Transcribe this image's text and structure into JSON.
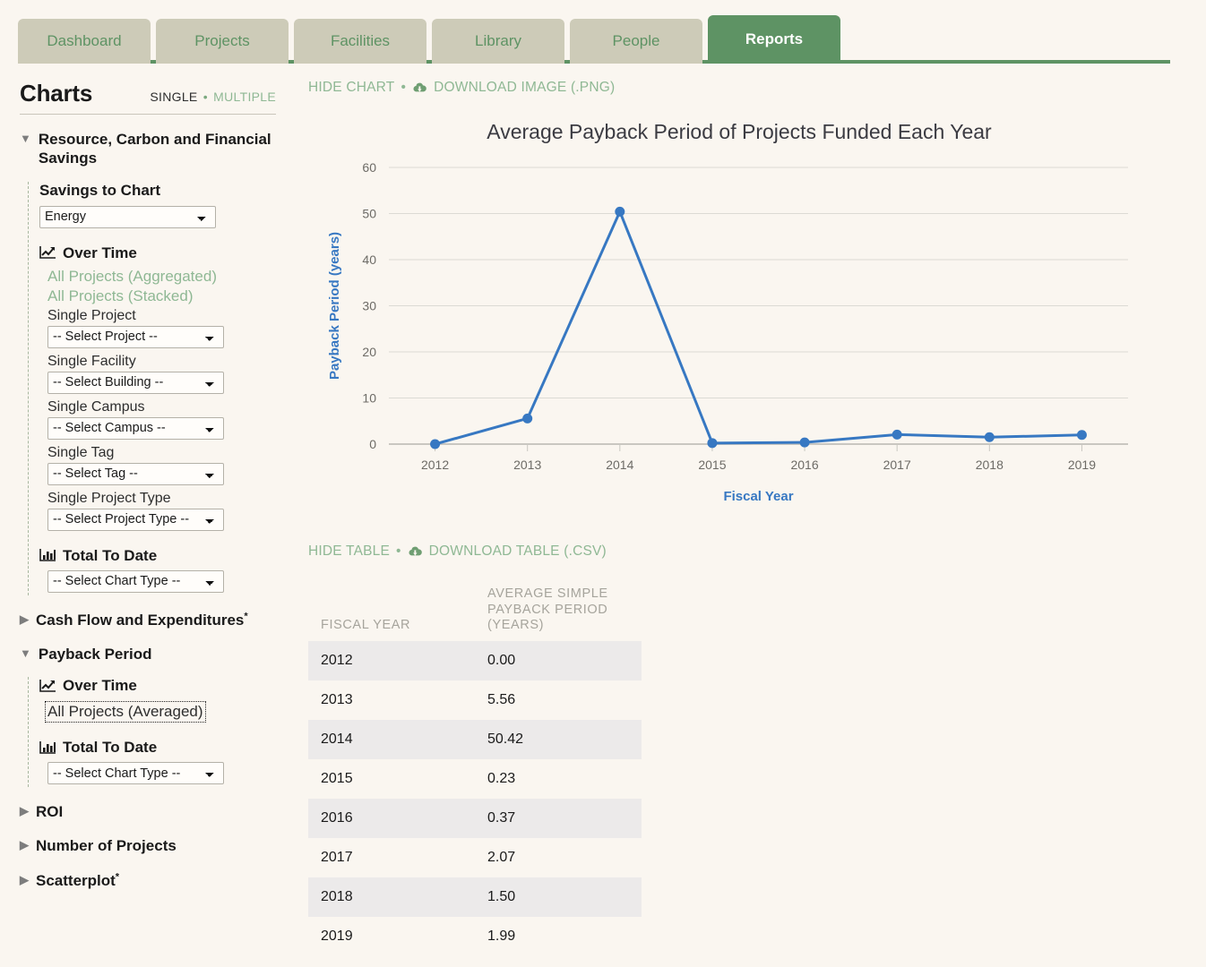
{
  "nav": {
    "tabs": [
      {
        "label": "Dashboard",
        "active": false
      },
      {
        "label": "Projects",
        "active": false
      },
      {
        "label": "Facilities",
        "active": false
      },
      {
        "label": "Library",
        "active": false
      },
      {
        "label": "People",
        "active": false
      },
      {
        "label": "Reports",
        "active": true
      }
    ]
  },
  "sidebar": {
    "title": "Charts",
    "mode": {
      "single": "SINGLE",
      "separator": "•",
      "multiple": "MULTIPLE"
    },
    "sections": [
      {
        "caret": "▼",
        "title": "Resource, Carbon and Financial Savings",
        "expanded": true,
        "savings_label": "Savings to Chart",
        "savings_value": "Energy",
        "over_time_label": "Over Time",
        "links": [
          "All Projects (Aggregated)",
          "All Projects (Stacked)"
        ],
        "fields": [
          {
            "label": "Single Project",
            "value": "-- Select Project --"
          },
          {
            "label": "Single Facility",
            "value": "-- Select Building --"
          },
          {
            "label": "Single Campus",
            "value": "-- Select Campus --"
          },
          {
            "label": "Single Tag",
            "value": "-- Select Tag --"
          },
          {
            "label": "Single Project Type",
            "value": "-- Select Project Type --"
          }
        ],
        "total_to_date_label": "Total To Date",
        "total_to_date_value": "-- Select Chart Type --"
      },
      {
        "caret": "▶",
        "title": "Cash Flow and Expenditures",
        "superscript": "*",
        "expanded": false
      },
      {
        "caret": "▼",
        "title": "Payback Period",
        "expanded": true,
        "over_time_label": "Over Time",
        "selected_link": "All Projects (Averaged)",
        "total_to_date_label": "Total To Date",
        "total_to_date_value": "-- Select Chart Type --"
      },
      {
        "caret": "▶",
        "title": "ROI",
        "expanded": false
      },
      {
        "caret": "▶",
        "title": "Number of Projects",
        "expanded": false
      },
      {
        "caret": "▶",
        "title": "Scatterplot",
        "superscript": "*",
        "expanded": false
      }
    ]
  },
  "main": {
    "chart_toolbar": {
      "hide": "HIDE CHART",
      "separator": "•",
      "download": "DOWNLOAD IMAGE (.PNG)"
    },
    "table_toolbar": {
      "hide": "HIDE TABLE",
      "separator": "•",
      "download": "DOWNLOAD TABLE (.CSV)"
    },
    "table": {
      "headers": [
        "FISCAL YEAR",
        "AVERAGE SIMPLE PAYBACK PERIOD (YEARS)"
      ],
      "rows": [
        [
          "2012",
          "0.00"
        ],
        [
          "2013",
          "5.56"
        ],
        [
          "2014",
          "50.42"
        ],
        [
          "2015",
          "0.23"
        ],
        [
          "2016",
          "0.37"
        ],
        [
          "2017",
          "2.07"
        ],
        [
          "2018",
          "1.50"
        ],
        [
          "2019",
          "1.99"
        ]
      ]
    }
  },
  "colors": {
    "accent_green": "#5e9364",
    "link_green": "#8fb894",
    "tab_inactive": "#cdcbb8",
    "line_blue": "#3778c2",
    "page_bg": "#faf6f0"
  },
  "chart_data": {
    "type": "line",
    "title": "Average Payback Period of Projects Funded Each Year",
    "xlabel": "Fiscal Year",
    "ylabel": "Payback Period (years)",
    "x": [
      "2012",
      "2013",
      "2014",
      "2015",
      "2016",
      "2017",
      "2018",
      "2019"
    ],
    "values": [
      0.0,
      5.56,
      50.42,
      0.23,
      0.37,
      2.07,
      1.5,
      1.99
    ],
    "yticks": [
      0,
      10,
      20,
      30,
      40,
      50,
      60
    ],
    "ylim": [
      0,
      60
    ],
    "grid": true,
    "legend": "none",
    "series_color": "#3778c2",
    "marker": "circle"
  }
}
